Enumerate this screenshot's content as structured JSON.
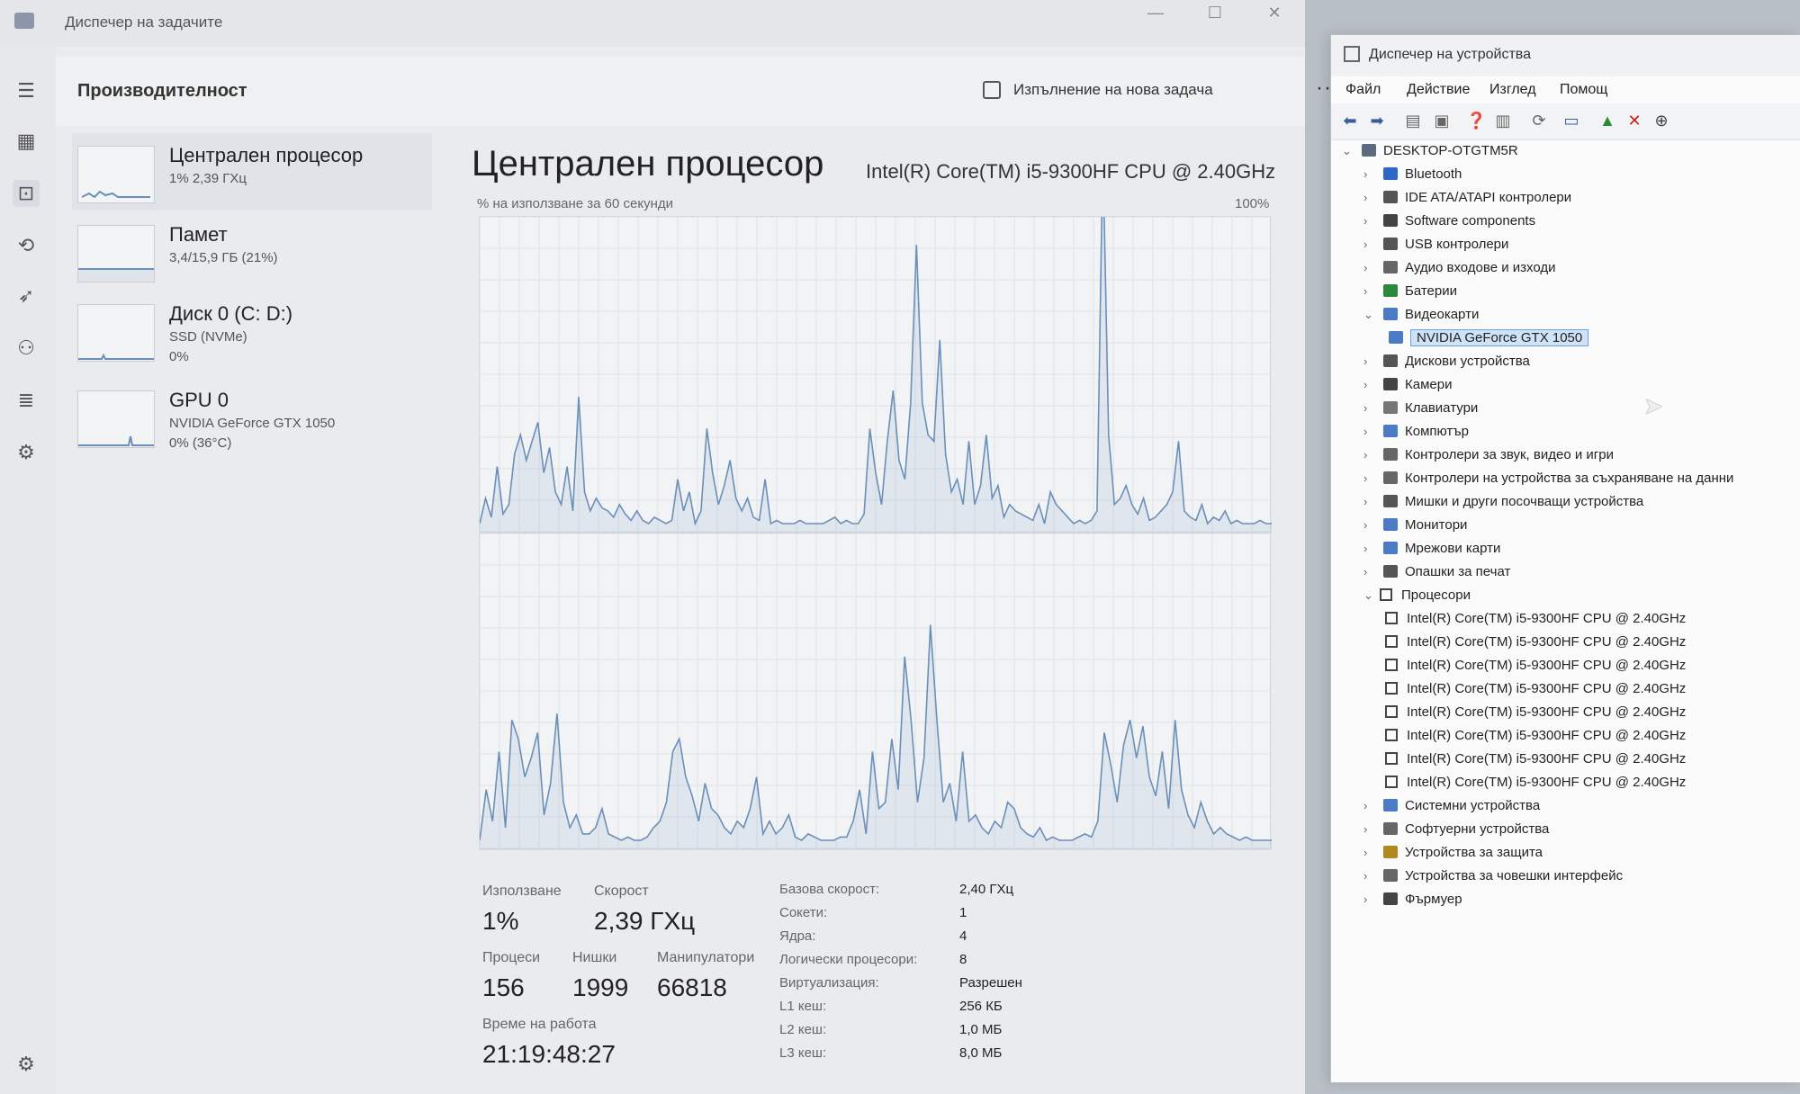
{
  "task_manager": {
    "window_title": "Диспечер на задачите",
    "page_title": "Производителност",
    "new_task_label": "Изпълнение на нова задача",
    "more_label": "···",
    "nav_icons": [
      "hamburger-icon",
      "processes-icon",
      "performance-icon",
      "app-history-icon",
      "startup-icon",
      "users-icon",
      "details-icon",
      "services-icon",
      "settings-icon"
    ],
    "perf_items": [
      {
        "name": "Централен процесор",
        "sub1": "1% 2,39 ГХц",
        "sub2": "",
        "sub3": ""
      },
      {
        "name": "Памет",
        "sub1": "3,4/15,9 ГБ (21%)",
        "sub2": "",
        "sub3": ""
      },
      {
        "name": "Диск 0 (C: D:)",
        "sub1": "SSD (NVMe)",
        "sub2": "0%",
        "sub3": ""
      },
      {
        "name": "GPU 0",
        "sub1": "NVIDIA GeForce GTX 1050",
        "sub2": "0% (36°C)",
        "sub3": ""
      }
    ],
    "cpu": {
      "title": "Централен процесор",
      "model": "Intel(R) Core(TM) i5-9300HF CPU @ 2.40GHz",
      "usage_label": "% на използване за 60 секунди",
      "usage_max": "100%"
    },
    "stats": {
      "usage_label": "Използване",
      "usage_value": "1%",
      "speed_label": "Скорост",
      "speed_value": "2,39 ГХц",
      "processes_label": "Процеси",
      "processes_value": "156",
      "threads_label": "Нишки",
      "threads_value": "1999",
      "handles_label": "Манипулатори",
      "handles_value": "66818",
      "uptime_label": "Време на работа",
      "uptime_value": "21:19:48:27"
    },
    "info": [
      {
        "label": "Базова скорост:",
        "value": "2,40 ГХц"
      },
      {
        "label": "Сокети:",
        "value": "1"
      },
      {
        "label": "Ядра:",
        "value": "4"
      },
      {
        "label": "Логически процесори:",
        "value": "8"
      },
      {
        "label": "Виртуализация:",
        "value": "Разрешен"
      },
      {
        "label": "L1 кеш:",
        "value": "256 КБ"
      },
      {
        "label": "L2 кеш:",
        "value": "1,0 МБ"
      },
      {
        "label": "L3 кеш:",
        "value": "8,0 МБ"
      }
    ],
    "graph_color": "#6b8fb8",
    "graph_top_series": [
      2,
      10,
      4,
      20,
      5,
      8,
      24,
      30,
      22,
      28,
      34,
      18,
      26,
      12,
      8,
      20,
      6,
      42,
      12,
      6,
      10,
      7,
      6,
      4,
      8,
      5,
      3,
      6,
      3,
      2,
      4,
      3,
      2,
      3,
      16,
      6,
      12,
      2,
      6,
      32,
      18,
      8,
      14,
      22,
      10,
      6,
      10,
      4,
      3,
      16,
      2,
      3,
      2,
      2,
      2,
      3,
      2,
      2,
      2,
      2,
      3,
      4,
      2,
      3,
      2,
      2,
      5,
      32,
      18,
      8,
      28,
      44,
      22,
      16,
      40,
      90,
      40,
      30,
      28,
      60,
      24,
      12,
      16,
      8,
      28,
      8,
      14,
      30,
      10,
      14,
      4,
      8,
      6,
      5,
      4,
      3,
      8,
      2,
      12,
      8,
      6,
      4,
      2,
      3,
      2,
      3,
      6,
      120,
      30,
      8,
      10,
      14,
      8,
      5,
      10,
      3,
      4,
      6,
      8,
      12,
      28,
      6,
      4,
      3,
      8,
      2,
      4,
      3,
      6,
      2,
      3,
      2,
      2,
      2,
      3,
      2,
      2
    ],
    "graph_bottom_series": [
      2,
      18,
      8,
      30,
      6,
      40,
      34,
      22,
      28,
      36,
      10,
      20,
      42,
      14,
      6,
      10,
      4,
      4,
      6,
      12,
      4,
      3,
      2,
      3,
      2,
      2,
      3,
      6,
      8,
      14,
      30,
      34,
      22,
      16,
      8,
      20,
      12,
      10,
      6,
      4,
      8,
      6,
      12,
      22,
      4,
      8,
      4,
      6,
      10,
      3,
      2,
      4,
      3,
      2,
      2,
      2,
      3,
      3,
      8,
      18,
      4,
      30,
      12,
      14,
      34,
      18,
      60,
      40,
      14,
      28,
      70,
      40,
      14,
      20,
      8,
      30,
      8,
      10,
      6,
      4,
      8,
      6,
      14,
      12,
      6,
      4,
      3,
      6,
      2,
      3,
      2,
      2,
      2,
      3,
      4,
      3,
      8,
      36,
      26,
      14,
      32,
      40,
      28,
      38,
      22,
      16,
      30,
      12,
      40,
      18,
      10,
      6,
      14,
      8,
      4,
      6,
      4,
      3,
      2,
      3,
      2,
      2,
      2,
      2
    ]
  },
  "device_manager": {
    "window_title": "Диспечер на устройства",
    "menu": [
      "Файл",
      "Действие",
      "Изглед",
      "Помощ"
    ],
    "toolbar_icons": [
      "back-icon",
      "forward-icon",
      "properties-icon",
      "update-icon",
      "help-icon",
      "view-icon",
      "scan-icon",
      "monitor-icon",
      "add-driver-icon",
      "remove-icon",
      "download-icon"
    ],
    "tree": [
      {
        "label": "DESKTOP-OTGTM5R",
        "level": 0,
        "expanded": true,
        "icon": "computer",
        "color": "#5a6b80"
      },
      {
        "label": "Bluetooth",
        "level": 1,
        "expanded": false,
        "icon": "bluetooth",
        "color": "#2e67c9"
      },
      {
        "label": "IDE ATA/ATAPI контролери",
        "level": 1,
        "expanded": false,
        "icon": "ide",
        "color": "#555"
      },
      {
        "label": "Software components",
        "level": 1,
        "expanded": false,
        "icon": "component",
        "color": "#444"
      },
      {
        "label": "USB контролери",
        "level": 1,
        "expanded": false,
        "icon": "usb",
        "color": "#555"
      },
      {
        "label": "Аудио входове и изходи",
        "level": 1,
        "expanded": false,
        "icon": "audio",
        "color": "#666"
      },
      {
        "label": "Батерии",
        "level": 1,
        "expanded": false,
        "icon": "battery",
        "color": "#2a8a3a"
      },
      {
        "label": "Видеокарти",
        "level": 1,
        "expanded": true,
        "icon": "display",
        "color": "#4a7bc4"
      },
      {
        "label": "NVIDIA GeForce GTX 1050",
        "level": 2,
        "expanded": null,
        "icon": "display",
        "color": "#4a7bc4",
        "selected": true
      },
      {
        "label": "Дискови устройства",
        "level": 1,
        "expanded": false,
        "icon": "disk",
        "color": "#555"
      },
      {
        "label": "Камери",
        "level": 1,
        "expanded": false,
        "icon": "camera",
        "color": "#444"
      },
      {
        "label": "Клавиатури",
        "level": 1,
        "expanded": false,
        "icon": "keyboard",
        "color": "#777"
      },
      {
        "label": "Компютър",
        "level": 1,
        "expanded": false,
        "icon": "computer",
        "color": "#4a7bc4"
      },
      {
        "label": "Контролери за звук, видео и игри",
        "level": 1,
        "expanded": false,
        "icon": "sound",
        "color": "#666"
      },
      {
        "label": "Контролери на устройства за съхраняване на данни",
        "level": 1,
        "expanded": false,
        "icon": "storage",
        "color": "#666"
      },
      {
        "label": "Мишки и други посочващи устройства",
        "level": 1,
        "expanded": false,
        "icon": "mouse",
        "color": "#555"
      },
      {
        "label": "Монитори",
        "level": 1,
        "expanded": false,
        "icon": "monitor",
        "color": "#4a7bc4"
      },
      {
        "label": "Мрежови карти",
        "level": 1,
        "expanded": false,
        "icon": "network",
        "color": "#4a7bc4"
      },
      {
        "label": "Опашки за печат",
        "level": 1,
        "expanded": false,
        "icon": "printer",
        "color": "#555"
      },
      {
        "label": "Процесори",
        "level": 1,
        "expanded": true,
        "icon": "cpu",
        "color": "#333"
      },
      {
        "label": "Intel(R) Core(TM) i5-9300HF CPU @ 2.40GHz",
        "level": 2,
        "expanded": null,
        "icon": "cpu",
        "color": "#333"
      },
      {
        "label": "Intel(R) Core(TM) i5-9300HF CPU @ 2.40GHz",
        "level": 2,
        "expanded": null,
        "icon": "cpu",
        "color": "#333"
      },
      {
        "label": "Intel(R) Core(TM) i5-9300HF CPU @ 2.40GHz",
        "level": 2,
        "expanded": null,
        "icon": "cpu",
        "color": "#333"
      },
      {
        "label": "Intel(R) Core(TM) i5-9300HF CPU @ 2.40GHz",
        "level": 2,
        "expanded": null,
        "icon": "cpu",
        "color": "#333"
      },
      {
        "label": "Intel(R) Core(TM) i5-9300HF CPU @ 2.40GHz",
        "level": 2,
        "expanded": null,
        "icon": "cpu",
        "color": "#333"
      },
      {
        "label": "Intel(R) Core(TM) i5-9300HF CPU @ 2.40GHz",
        "level": 2,
        "expanded": null,
        "icon": "cpu",
        "color": "#333"
      },
      {
        "label": "Intel(R) Core(TM) i5-9300HF CPU @ 2.40GHz",
        "level": 2,
        "expanded": null,
        "icon": "cpu",
        "color": "#333"
      },
      {
        "label": "Intel(R) Core(TM) i5-9300HF CPU @ 2.40GHz",
        "level": 2,
        "expanded": null,
        "icon": "cpu",
        "color": "#333"
      },
      {
        "label": "Системни устройства",
        "level": 1,
        "expanded": false,
        "icon": "system",
        "color": "#4a7bc4"
      },
      {
        "label": "Софтуерни устройства",
        "level": 1,
        "expanded": false,
        "icon": "software",
        "color": "#666"
      },
      {
        "label": "Устройства за защита",
        "level": 1,
        "expanded": false,
        "icon": "security",
        "color": "#b08a1e"
      },
      {
        "label": "Устройства за човешки интерфейс",
        "level": 1,
        "expanded": false,
        "icon": "hid",
        "color": "#666"
      },
      {
        "label": "Фърмуер",
        "level": 1,
        "expanded": false,
        "icon": "firmware",
        "color": "#444"
      }
    ]
  }
}
